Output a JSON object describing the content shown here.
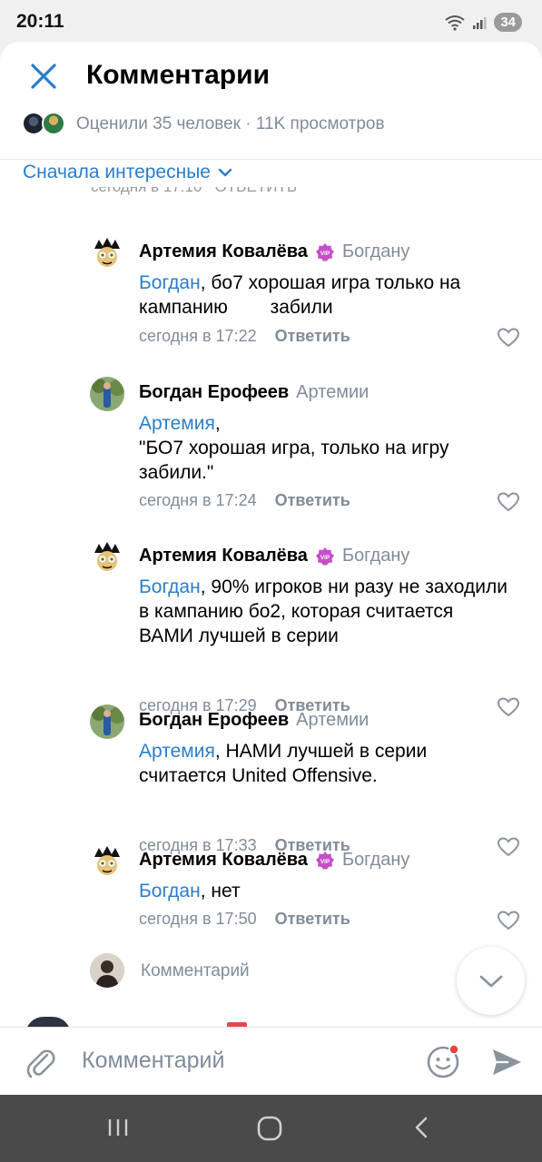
{
  "status_bar": {
    "time": "20:11",
    "battery": "34"
  },
  "header": {
    "title": "Комментарии",
    "stats": "Оценили 35 человек · 11K просмотров"
  },
  "sort": {
    "label": "Сначала интересные"
  },
  "comments": [
    {
      "author": "Артемия Ковалёва",
      "reply_to": "Богдану",
      "mention": "Богдан",
      "text": ", бо7 хорошая игра только на кампанию        забили",
      "time": "сегодня в 17:22",
      "reply_label": "Ответить",
      "vip": true
    },
    {
      "author": "Богдан Ерофеев",
      "reply_to": "Артемии",
      "mention": "Артемия",
      "text": ",\n\"БО7 хорошая игра, только на игру забили.\"",
      "time": "сегодня в 17:24",
      "reply_label": "Ответить",
      "vip": false
    },
    {
      "author": "Артемия Ковалёва",
      "reply_to": "Богдану",
      "mention": "Богдан",
      "text": ", 90% игроков ни разу не заходили в кампанию бо2, которая считается ВАМИ лучшей в серии",
      "time": "сегодня в 17:29",
      "reply_label": "Ответить",
      "vip": true
    },
    {
      "author": "Богдан Ерофеев",
      "reply_to": "Артемии",
      "mention": "Артемия",
      "text": ", НАМИ лучшей в серии считается United Offensive.",
      "time": "сегодня в 17:33",
      "reply_label": "Ответить",
      "vip": false
    },
    {
      "author": "Артемия Ковалёва",
      "reply_to": "Богдану",
      "mention": "Богдан",
      "text": ", нет",
      "time": "сегодня в 17:50",
      "reply_label": "Ответить",
      "vip": true
    }
  ],
  "reply_field": {
    "placeholder": "Комментарий"
  },
  "composer": {
    "placeholder": "Комментарий"
  },
  "colors": {
    "accent": "#2a7ec9",
    "muted": "#818c99",
    "vip": "#c54fc8"
  },
  "icons": [
    "close-icon",
    "chevron-down-icon",
    "heart-icon",
    "paperclip-icon",
    "smile-icon",
    "send-icon",
    "vip-badge-icon"
  ]
}
